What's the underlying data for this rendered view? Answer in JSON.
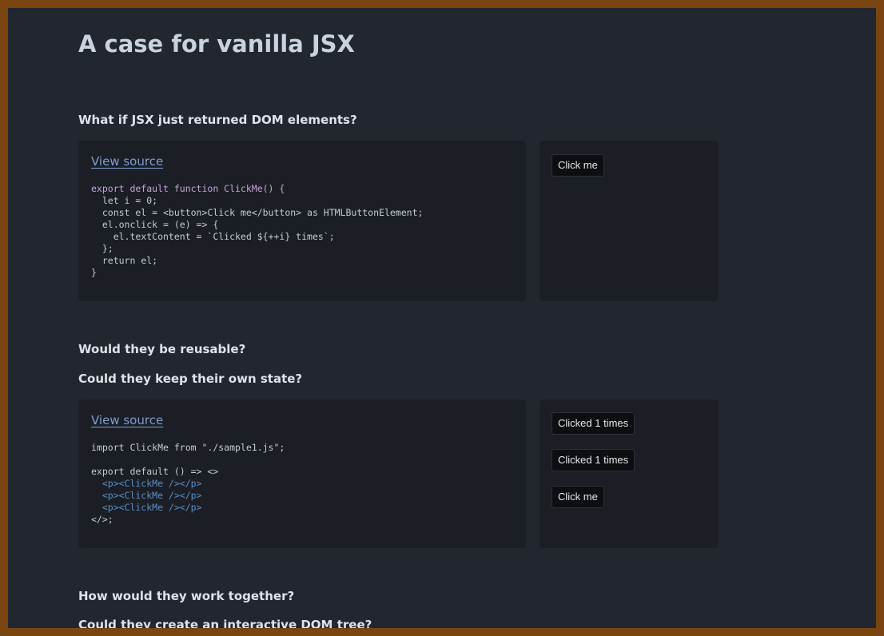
{
  "page": {
    "title": "A case for vanilla JSX"
  },
  "sections": [
    {
      "heading": "What if JSX just returned DOM elements?"
    },
    {
      "heading_1": "Would they be reusable?",
      "heading_2": "Could they keep their own state?"
    },
    {
      "heading_1": "How would they work together?",
      "heading_2": "Could they create an interactive DOM tree?"
    }
  ],
  "examples": [
    {
      "view_source_label": "View source",
      "code_lines": [
        "export default function ClickMe() {",
        "  let i = 0;",
        "  const el = <button>Click me</button> as HTMLButtonElement;",
        "  el.onclick = (e) => {",
        "    el.textContent = `Clicked ${++i} times`;",
        "  };",
        "  return el;",
        "}"
      ],
      "buttons": [
        "Click me"
      ]
    },
    {
      "view_source_label": "View source",
      "code_lines": [
        "import ClickMe from \"./sample1.js\";",
        "",
        "export default () => <>",
        "  <p><ClickMe /></p>",
        "  <p><ClickMe /></p>",
        "  <p><ClickMe /></p>",
        "</>;"
      ],
      "buttons": [
        "Clicked 1 times",
        "Clicked 1 times",
        "Click me"
      ]
    }
  ],
  "colors": {
    "page_background": "#22262e",
    "frame_border": "#7a4510",
    "card_background": "#1b1e25",
    "link": "#7c9fcf",
    "button_background": "#0d0e11"
  }
}
